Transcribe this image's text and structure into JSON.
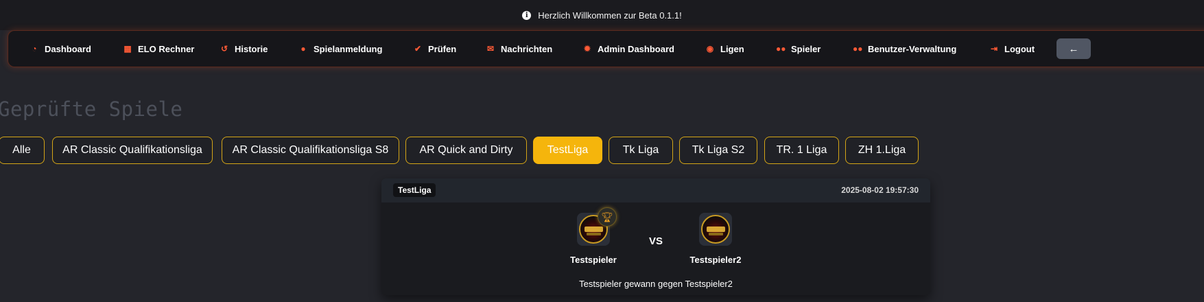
{
  "banner": {
    "icon": "info-icon",
    "text": "Herzlich Willkommen zur Beta 0.1.1!"
  },
  "nav": {
    "items": [
      {
        "label": "Dashboard",
        "icon": "gauge-icon"
      },
      {
        "label": "ELO Rechner",
        "icon": "calculator-icon"
      },
      {
        "label": "Historie",
        "icon": "history-icon"
      },
      {
        "label": "Spielanmeldung",
        "icon": "dice-icon"
      },
      {
        "label": "Prüfen",
        "icon": "check-icon"
      },
      {
        "label": "Nachrichten",
        "icon": "envelope-icon"
      },
      {
        "label": "Admin Dashboard",
        "icon": "gear-icon"
      },
      {
        "label": "Ligen",
        "icon": "football-icon"
      },
      {
        "label": "Spieler",
        "icon": "users-icon"
      },
      {
        "label": "Benutzer-Verwaltung",
        "icon": "users-cog-icon"
      },
      {
        "label": "Logout",
        "icon": "logout-icon"
      }
    ],
    "back_icon": "arrow-left-icon",
    "accent_color": "#ff5a36"
  },
  "page": {
    "title": "Geprüfte Spiele"
  },
  "tabs": [
    {
      "label": "Alle"
    },
    {
      "label": "AR Classic Qualifikationsliga"
    },
    {
      "label": "AR Classic Qualifikationsliga S8"
    },
    {
      "label": "AR Quick and Dirty"
    },
    {
      "label": "TestLiga",
      "active": true
    },
    {
      "label": "Tk Liga"
    },
    {
      "label": "Tk Liga S2"
    },
    {
      "label": "TR. 1 Liga"
    },
    {
      "label": "ZH 1.Liga"
    }
  ],
  "tab_colors": {
    "active": "#f5b50c",
    "border": "#d4a517"
  },
  "match": {
    "league": "TestLiga",
    "date": "2025-08-02 19:57:30",
    "player1": "Testspieler",
    "player2": "Testspieler2",
    "winner_icon": "trophy-icon",
    "vs": "VS",
    "result": "Testspieler gewann gegen Testspieler2"
  }
}
